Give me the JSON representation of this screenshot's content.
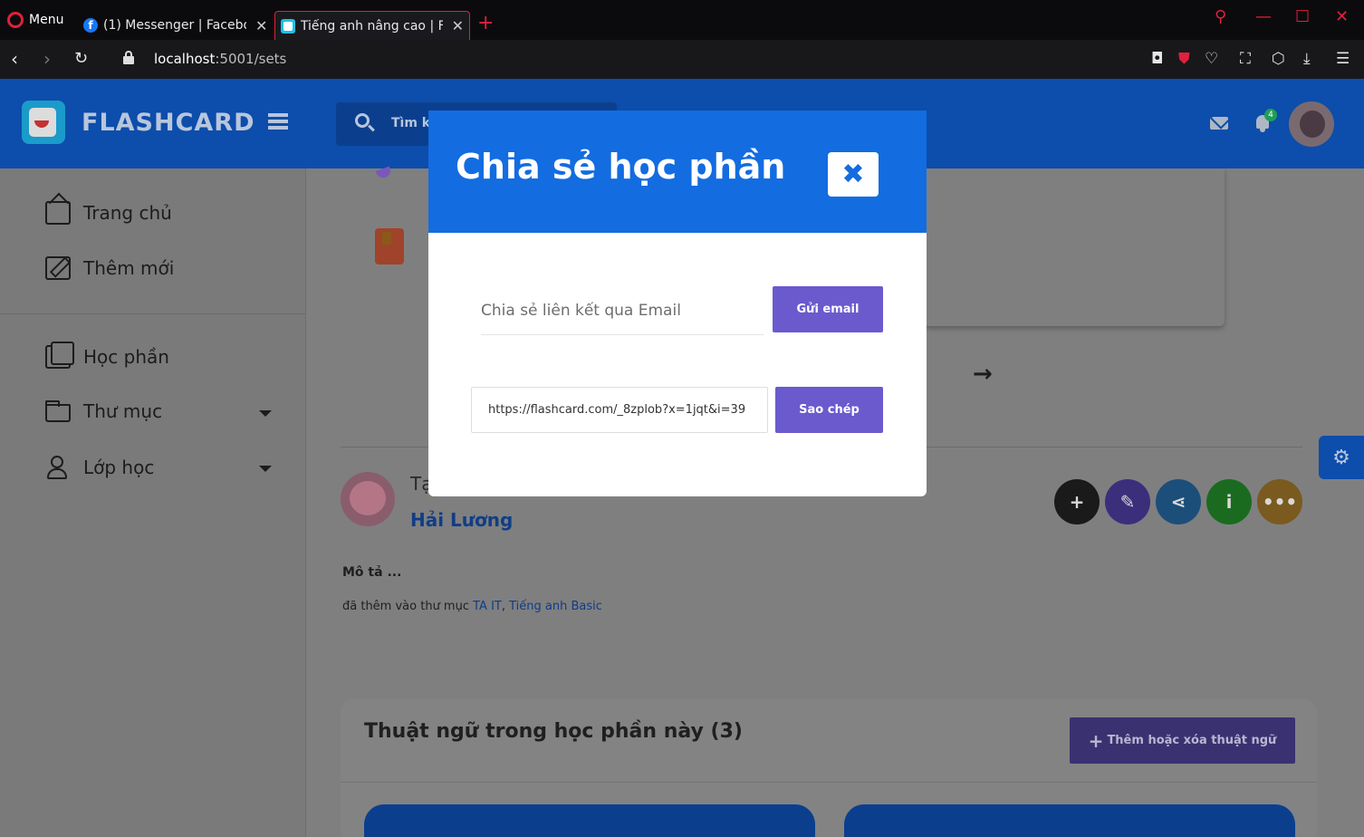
{
  "browser": {
    "menu_label": "Menu",
    "tabs": [
      {
        "label": "(1) Messenger | Facebook"
      },
      {
        "label": "Tiếng anh nâng cao | Flashcard"
      }
    ],
    "new_tab": "+",
    "url_host": "localhost",
    "url_rest": ":5001/sets"
  },
  "app": {
    "brand": "FLASHCARD",
    "search_placeholder": "Tìm ki",
    "notification_count": "4"
  },
  "sidebar": {
    "items": [
      {
        "label": "Trang chủ"
      },
      {
        "label": "Thêm mới"
      },
      {
        "label": "Học phần"
      },
      {
        "label": "Thư mục"
      },
      {
        "label": "Lớp học"
      }
    ]
  },
  "set": {
    "created_by_prefix": "Tạ",
    "author": "Hải Lương",
    "description": "Mô tả ...",
    "folders_prefix": "đã thêm vào thư mục ",
    "folder_1": "TA IT",
    "folder_sep": ", ",
    "folder_2": "Tiếng anh Basic",
    "terms_title": "Thuật ngữ trong học phần này (3)",
    "terms_button": "Thêm hoặc xóa thuật ngữ"
  },
  "modal": {
    "title": "Chia sẻ học phần",
    "email_placeholder": "Chia sẻ liên kết qua Email",
    "send_email_label": "Gửi email",
    "share_link": "https://flashcard.com/_8zplob?x=1jqt&i=39",
    "copy_label": "Sao chép"
  },
  "colors": {
    "primary": "#136ce0",
    "header": "#0d4dab",
    "button_purple": "#6a5acd",
    "action_add": "#1a1a1a",
    "action_edit": "#3b2f7c",
    "action_share": "#1c4e7a",
    "action_info": "#1a6b1f",
    "action_more": "#7a5a1e"
  }
}
